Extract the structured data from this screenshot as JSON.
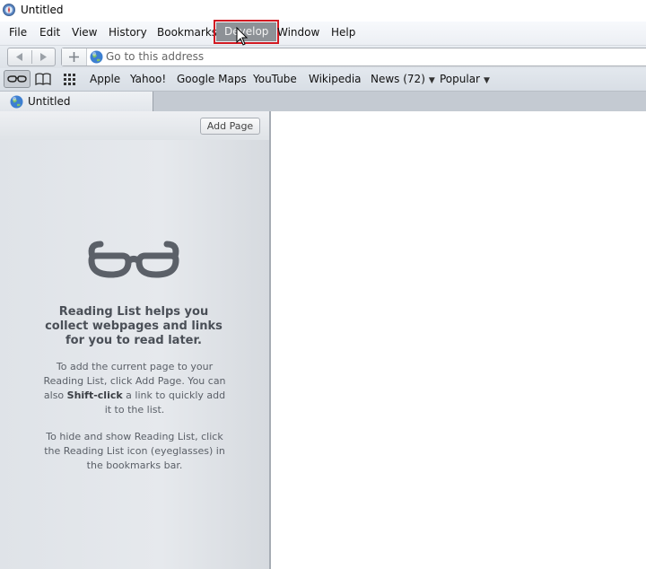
{
  "window": {
    "title": "Untitled"
  },
  "menu": {
    "items": [
      "File",
      "Edit",
      "View",
      "History",
      "Bookmarks",
      "Develop",
      "Window",
      "Help"
    ],
    "active": "Develop"
  },
  "address": {
    "placeholder": "Go to this address",
    "value": ""
  },
  "bookmarks": {
    "items": [
      "Apple",
      "Yahoo!",
      "Google Maps",
      "YouTube",
      "Wikipedia",
      "News (72)",
      "Popular"
    ]
  },
  "tab": {
    "title": "Untitled"
  },
  "reading_list": {
    "add_page_label": "Add Page",
    "heading": "Reading List helps you collect webpages and links for you to read later.",
    "para1_a": "To add the current page to your Reading List, click Add Page. You can also ",
    "para1_bold": "Shift-click",
    "para1_b": " a link to quickly add it to the list.",
    "para2": "To hide and show Reading List, click the Reading List icon (eyeglasses) in the bookmarks bar."
  },
  "colors": {
    "highlight": "#d11a22",
    "active_menu_bg": "#8d9196"
  },
  "icons": [
    "safari-icon",
    "back-arrow-icon",
    "forward-arrow-icon",
    "plus-icon",
    "globe-icon",
    "glasses-icon",
    "book-icon",
    "grid-icon",
    "cursor-icon"
  ]
}
